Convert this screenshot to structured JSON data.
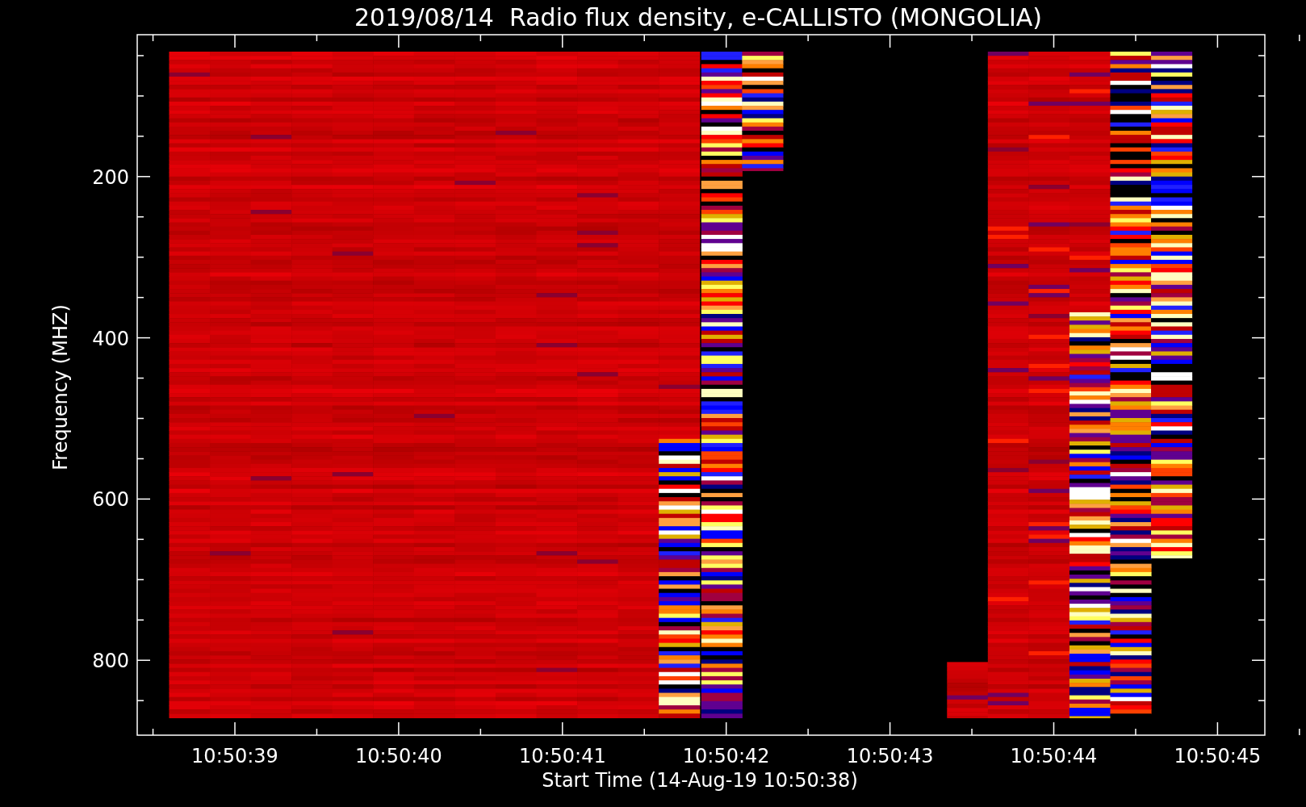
{
  "plot": {
    "title": "2019/08/14  Radio flux density, e-CALLISTO (MONGOLIA)",
    "ylabel": "Frequency (MHZ)",
    "xlabel": "Start Time (14-Aug-19 10:50:38)",
    "y_tick_labels": [
      "200",
      "400",
      "600",
      "800"
    ],
    "x_tick_labels": [
      "10:50:39",
      "10:50:40",
      "10:50:41",
      "10:50:42",
      "10:50:43",
      "10:50:44",
      "10:50:45"
    ]
  }
}
